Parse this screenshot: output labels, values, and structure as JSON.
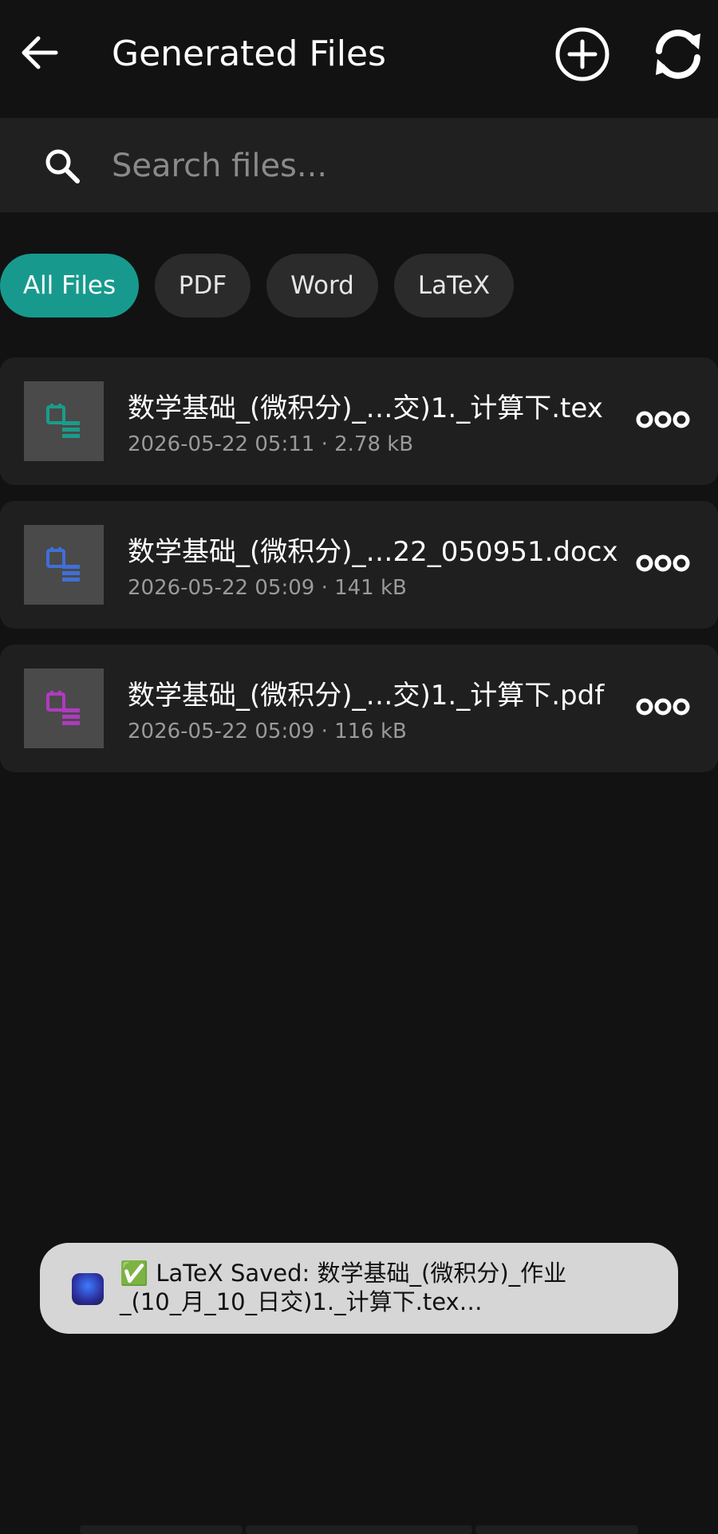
{
  "header": {
    "title": "Generated Files",
    "back_icon": "arrow-left-icon",
    "add_icon": "plus-circle-icon",
    "refresh_icon": "refresh-icon"
  },
  "search": {
    "placeholder": "Search files...",
    "value": "",
    "icon": "search-icon"
  },
  "filters": [
    {
      "label": "All Files",
      "active": true
    },
    {
      "label": "PDF",
      "active": false
    },
    {
      "label": "Word",
      "active": false
    },
    {
      "label": "LaTeX",
      "active": false
    }
  ],
  "files": [
    {
      "name": "数学基础_(微积分)_…交)1._计算下.tex",
      "date": "2026-05-22 05:11",
      "size": "2.78 kB",
      "icon": "file-tex-icon",
      "icon_color": "#1a9c8a",
      "more_icon": "more-options-icon"
    },
    {
      "name": "数学基础_(微积分)_…22_050951.docx",
      "date": "2026-05-22 05:09",
      "size": "141 kB",
      "icon": "file-word-icon",
      "icon_color": "#3f6fd8",
      "more_icon": "more-options-icon"
    },
    {
      "name": "数学基础_(微积分)_…交)1._计算下.pdf",
      "date": "2026-05-22 05:09",
      "size": "116 kB",
      "icon": "file-pdf-icon",
      "icon_color": "#b03ac0",
      "more_icon": "more-options-icon"
    }
  ],
  "meta_separator": "·",
  "toast": {
    "app_icon": "app-icon",
    "text": "✅ LaTeX Saved: 数学基础_(微积分)_作业\n_(10_月_10_日交)1._计算下.tex…"
  },
  "colors": {
    "background": "#121212",
    "accent": "#179a8d",
    "card": "#1f1f1f",
    "toast": "#d6d6d6"
  }
}
